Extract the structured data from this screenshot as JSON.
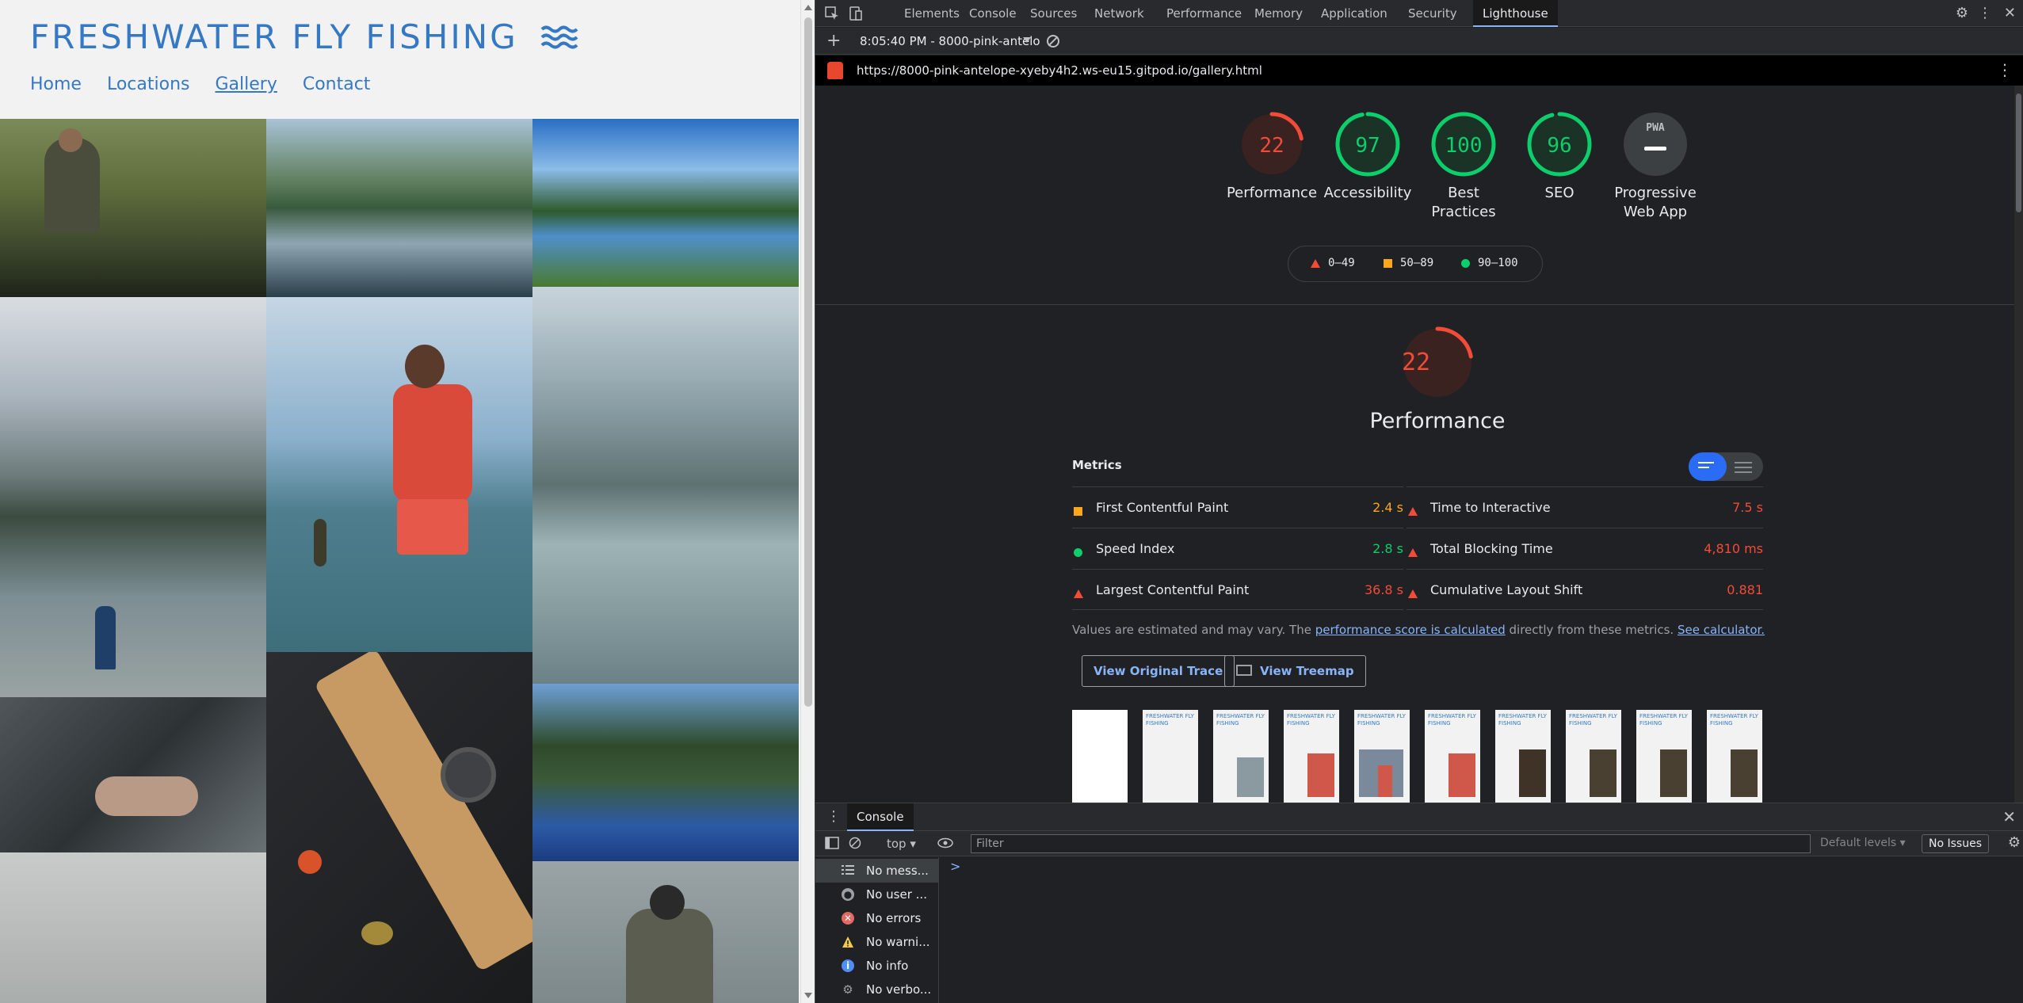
{
  "site": {
    "brand": "FRESHWATER FLY FISHING",
    "nav": [
      "Home",
      "Locations",
      "Gallery",
      "Contact"
    ],
    "active_nav": "Gallery"
  },
  "devtools": {
    "tabs": [
      "Elements",
      "Console",
      "Sources",
      "Network",
      "Performance",
      "Memory",
      "Application",
      "Security",
      "Lighthouse"
    ],
    "active_tab": "Lighthouse",
    "run_label": "8:05:40 PM - 8000-pink-antelo",
    "url": "https://8000-pink-antelope-xyeby4h2.ws-eu15.gitpod.io/gallery.html"
  },
  "scores": [
    {
      "label": "Performance",
      "value": "22",
      "color": "#f24b38"
    },
    {
      "label": "Accessibility",
      "value": "97",
      "color": "#0cce6b"
    },
    {
      "label": "Best Practices",
      "value": "100",
      "color": "#0cce6b"
    },
    {
      "label": "SEO",
      "value": "96",
      "color": "#0cce6b"
    }
  ],
  "pwa": {
    "badge": "PWA",
    "label": "Progressive Web App"
  },
  "legend": [
    "0–49",
    "50–89",
    "90–100"
  ],
  "performance": {
    "score": "22",
    "title": "Performance"
  },
  "metrics_heading": "Metrics",
  "metrics": [
    {
      "name": "First Contentful Paint",
      "value": "2.4 s",
      "status": "orange"
    },
    {
      "name": "Time to Interactive",
      "value": "7.5 s",
      "status": "red"
    },
    {
      "name": "Speed Index",
      "value": "2.8 s",
      "status": "green"
    },
    {
      "name": "Total Blocking Time",
      "value": "4,810 ms",
      "status": "red"
    },
    {
      "name": "Largest Contentful Paint",
      "value": "36.8 s",
      "status": "red"
    },
    {
      "name": "Cumulative Layout Shift",
      "value": "0.881",
      "status": "red"
    }
  ],
  "note": {
    "prefix": "Values are estimated and may vary. The ",
    "link1": "performance score is calculated",
    "middle": " directly from these metrics. ",
    "link2": "See calculator."
  },
  "buttons": {
    "trace": "View Original Trace",
    "treemap": "View Treemap"
  },
  "filmstrip_title": "FRESHWATER FLY FISHING",
  "console": {
    "tab": "Console",
    "context": "top",
    "filter_placeholder": "Filter",
    "levels": "Default levels",
    "issues": "No Issues",
    "sidebar": [
      {
        "label": "No mess...",
        "icon": "list-icon"
      },
      {
        "label": "No user ...",
        "icon": "user-icon"
      },
      {
        "label": "No errors",
        "icon": "error-icon"
      },
      {
        "label": "No warni...",
        "icon": "warning-icon"
      },
      {
        "label": "No info",
        "icon": "info-icon"
      },
      {
        "label": "No verbo...",
        "icon": "verbose-icon"
      }
    ],
    "prompt": ">"
  },
  "colors": {
    "red": "#f24b38",
    "orange": "#fca61a",
    "green": "#0cce6b",
    "brand": "#3578c4"
  }
}
